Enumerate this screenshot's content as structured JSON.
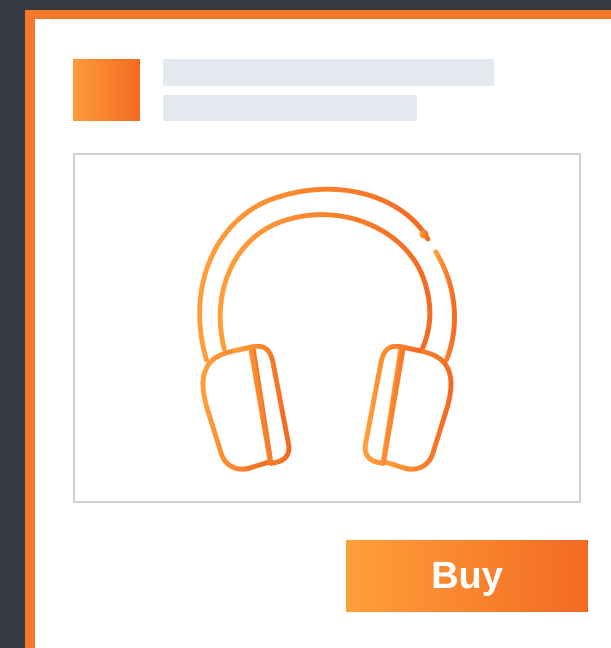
{
  "product": {
    "image_icon": "headphones-icon"
  },
  "actions": {
    "buy_label": "Buy"
  },
  "colors": {
    "background": "#353a44",
    "frame": "#f47a2a",
    "panel": "#ffffff",
    "skeleton": "#e4e9f0",
    "image_border": "#cdd0d7",
    "accent_start": "#ff9f3a",
    "accent_end": "#f36a22"
  }
}
